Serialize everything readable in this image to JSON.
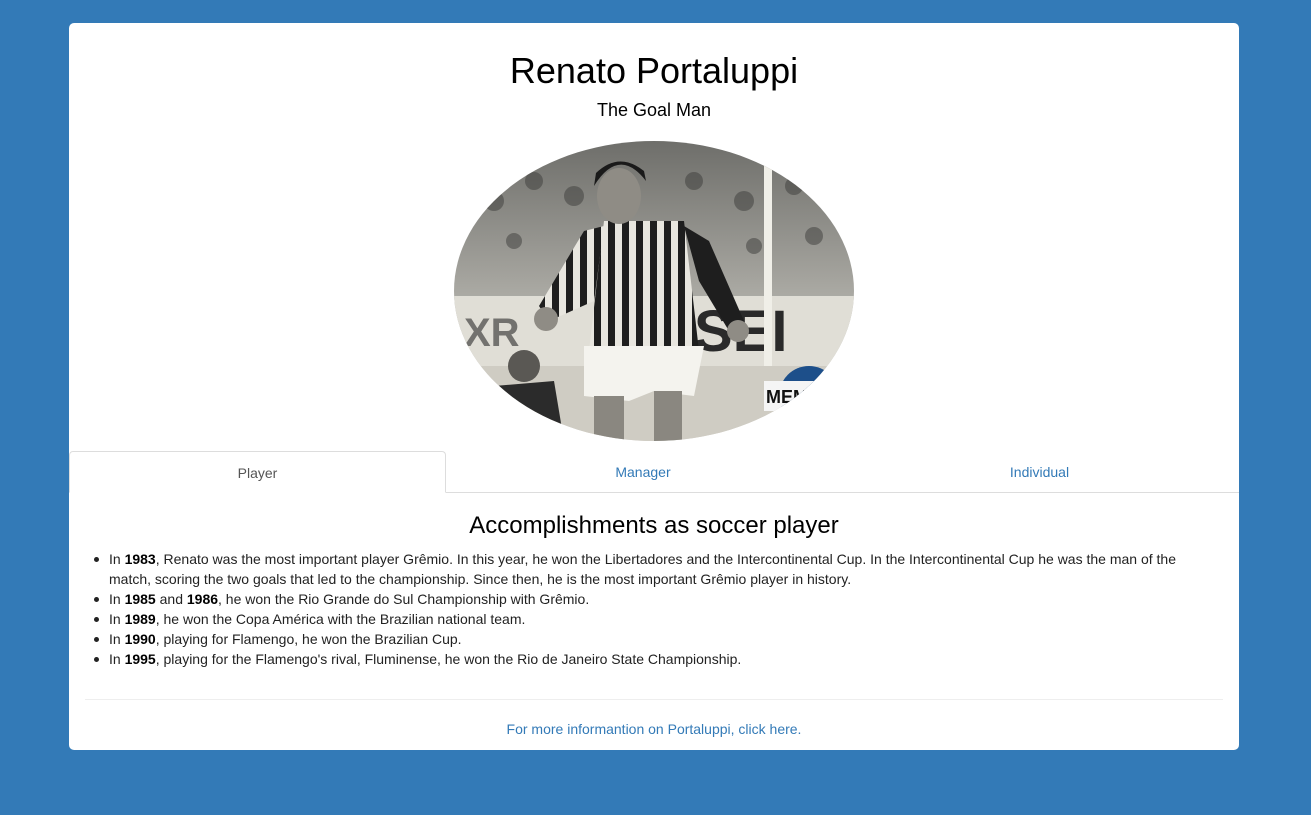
{
  "header": {
    "title": "Renato Portaluppi",
    "subtitle": "The Goal Man"
  },
  "photo": {
    "alt": "Renato Portaluppi"
  },
  "tabs": [
    {
      "label": "Player",
      "active": true
    },
    {
      "label": "Manager",
      "active": false
    },
    {
      "label": "Individual",
      "active": false
    }
  ],
  "section": {
    "title": "Accomplishments as soccer player"
  },
  "accomplishments": [
    {
      "pre": "In ",
      "b1": "1983",
      "mid": ", Renato was the most important player Grêmio. In this year, he won the Libertadores and the Intercontinental Cup. In the Intercontinental Cup he was the man of the match, scoring the two goals that led to the championship. Since then, he is the most important Grêmio player in history.",
      "b2": "",
      "post": ""
    },
    {
      "pre": "In ",
      "b1": "1985",
      "mid": " and ",
      "b2": "1986",
      "post": ", he won the Rio Grande do Sul Championship with Grêmio."
    },
    {
      "pre": "In ",
      "b1": "1989",
      "mid": ", he won the Copa América with the Brazilian national team.",
      "b2": "",
      "post": ""
    },
    {
      "pre": "In ",
      "b1": "1990",
      "mid": ", playing for Flamengo, he won the Brazilian Cup.",
      "b2": "",
      "post": ""
    },
    {
      "pre": "In ",
      "b1": "1995",
      "mid": ", playing for the Flamengo's rival, Fluminense, he won the Rio de Janeiro State Championship.",
      "b2": "",
      "post": ""
    }
  ],
  "footer": {
    "link_text": "For more informantion on Portaluppi, click here."
  },
  "colors": {
    "background": "#337ab7",
    "link": "#337ab7"
  }
}
